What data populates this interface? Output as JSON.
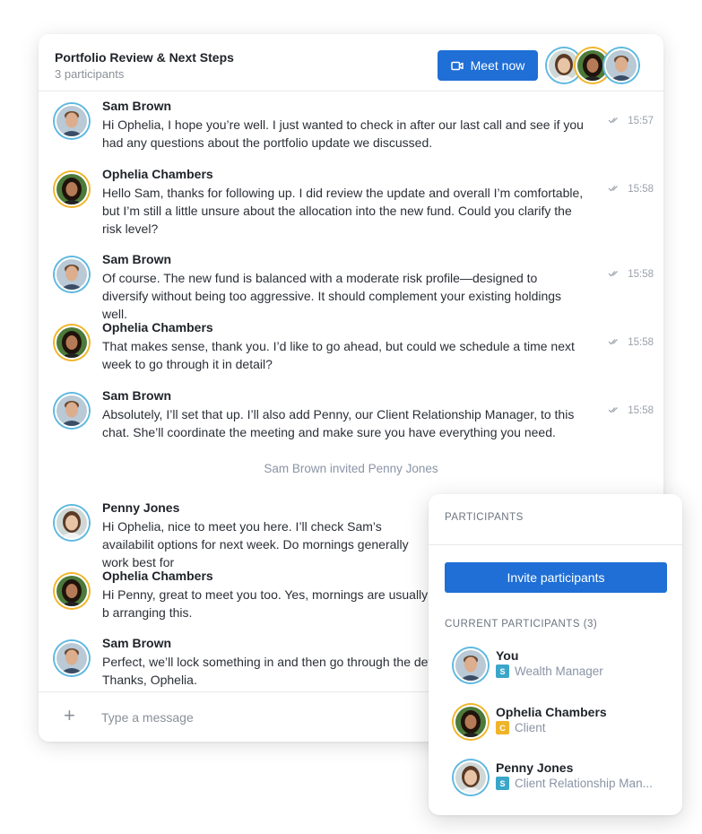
{
  "chat": {
    "title": "Portfolio Review & Next Steps",
    "subtitle": "3 participants",
    "meet_button_label": "Meet now",
    "messages": [
      {
        "name": "Sam Brown",
        "avatar": "sam",
        "text": "Hi Ophelia, I hope you’re well. I just wanted to check in after our last call and see if you had any questions about the portfolio update we discussed.",
        "time": "15:57"
      },
      {
        "name": "Ophelia Chambers",
        "avatar": "ophelia",
        "text": "Hello Sam, thanks for following up. I did review the update and overall I’m comfortable, but I’m still a little unsure about the allocation into the new fund. Could you clarify the risk level?",
        "time": "15:58"
      },
      {
        "name": "Sam Brown",
        "avatar": "sam",
        "text": "Of course. The new fund is balanced with a moderate risk profile—designed to diversify without being too aggressive. It should complement your existing holdings well.",
        "time": "15:58"
      },
      {
        "name": "Ophelia Chambers",
        "avatar": "ophelia",
        "text": "That makes sense, thank you. I’d like to go ahead, but could we schedule a time next week to go through it in detail?",
        "time": "15:58"
      },
      {
        "name": "Sam Brown",
        "avatar": "sam",
        "text": "Absolutely, I’ll set that up. I’ll also add Penny, our Client Relationship Manager, to this chat. She’ll coordinate the meeting and make sure you have everything you need.",
        "time": "15:58"
      },
      {
        "name": "Penny Jones",
        "avatar": "penny",
        "text": "Hi Ophelia, nice to meet you here. I’ll check Sam’s availabilit options for next week. Do mornings generally work best for",
        "time": ""
      },
      {
        "name": "Ophelia Chambers",
        "avatar": "ophelia",
        "text": "Hi Penny, great to meet you too. Yes, mornings are usually b arranging this.",
        "time": ""
      },
      {
        "name": "Sam Brown",
        "avatar": "sam",
        "text": "Perfect, we’ll lock something in and then go through the det Thanks, Ophelia.",
        "time": ""
      }
    ],
    "system_message": "Sam Brown invited Penny Jones",
    "composer_placeholder": "Type a message"
  },
  "participants_panel": {
    "title": "PARTICIPANTS",
    "invite_button_label": "Invite participants",
    "current_label": "CURRENT PARTICIPANTS (3)",
    "people": [
      {
        "name": "You",
        "badge": "S",
        "badge_color": "#3aa6c9",
        "role": "Wealth Manager",
        "avatar": "sam"
      },
      {
        "name": "Ophelia Chambers",
        "badge": "C",
        "badge_color": "#f0b429",
        "role": "Client",
        "avatar": "ophelia"
      },
      {
        "name": "Penny Jones",
        "badge": "S",
        "badge_color": "#3aa6c9",
        "role": "Client Relationship Man...",
        "avatar": "penny"
      }
    ]
  },
  "colors": {
    "primary_button": "#1f6fd6",
    "staff_ring": "#5db8e0",
    "client_ring": "#f0b429"
  },
  "icons": {
    "meet": "video-camera-icon",
    "read_receipt": "double-check-icon",
    "attach": "plus-icon"
  }
}
